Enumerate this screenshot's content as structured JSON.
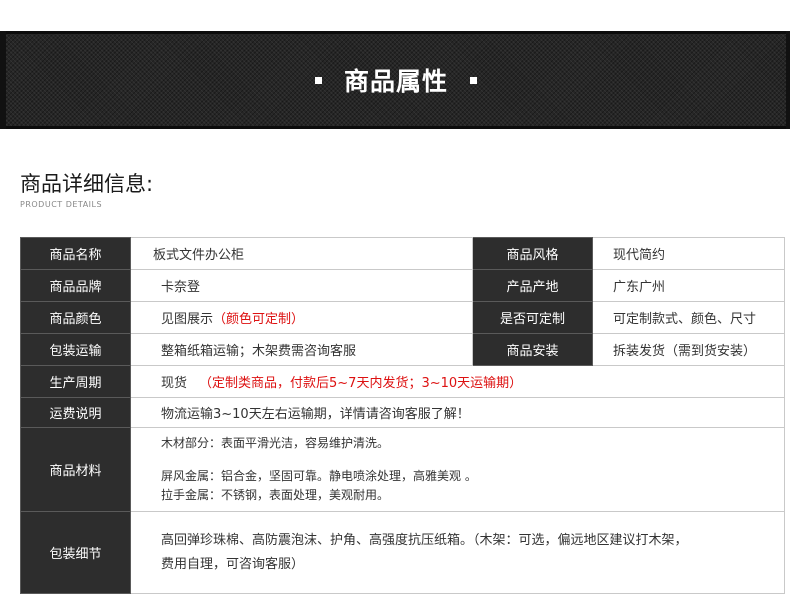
{
  "banner": {
    "title": "商品属性"
  },
  "section": {
    "title": "商品详细信息:",
    "subtitle": "PRODUCT DETAILS"
  },
  "attributes": {
    "name_label": "商品名称",
    "name_value": "板式文件办公柜",
    "style_label": "商品风格",
    "style_value": "现代简约",
    "brand_label": "商品品牌",
    "brand_value": "卡奈登",
    "origin_label": "产品产地",
    "origin_value": "广东广州",
    "color_label": "商品颜色",
    "color_value": "见图展示",
    "color_note": "（颜色可定制）",
    "custom_label": "是否可定制",
    "custom_value": "可定制款式、颜色、尺寸",
    "packing_label": "包装运输",
    "packing_value": "整箱纸箱运输；木架费需咨询客服",
    "install_label": "商品安装",
    "install_value": "拆装发货（需到货安装）",
    "cycle_label": "生产周期",
    "cycle_value": "现货",
    "cycle_note": "（定制类商品，付款后5~7天内发货；3~10天运输期）",
    "freight_label": "运费说明",
    "freight_value": "物流运输3~10天左右运输期，详情请咨询客服了解！",
    "material_label": "商品材料",
    "material_lines": [
      "木材部分：表面平滑光洁，容易维护清洗。",
      "屏风金属：铝合金，坚固可靠。静电喷涂处理，高雅美观 。",
      "拉手金属：不锈钢，表面处理，美观耐用。"
    ],
    "detail_label": "包装细节",
    "detail_lines": [
      "高回弹珍珠棉、高防震泡沫、护角、高强度抗压纸箱。（木架：可选，偏远地区建议打木架，",
      "费用自理，可咨询客服）"
    ]
  }
}
